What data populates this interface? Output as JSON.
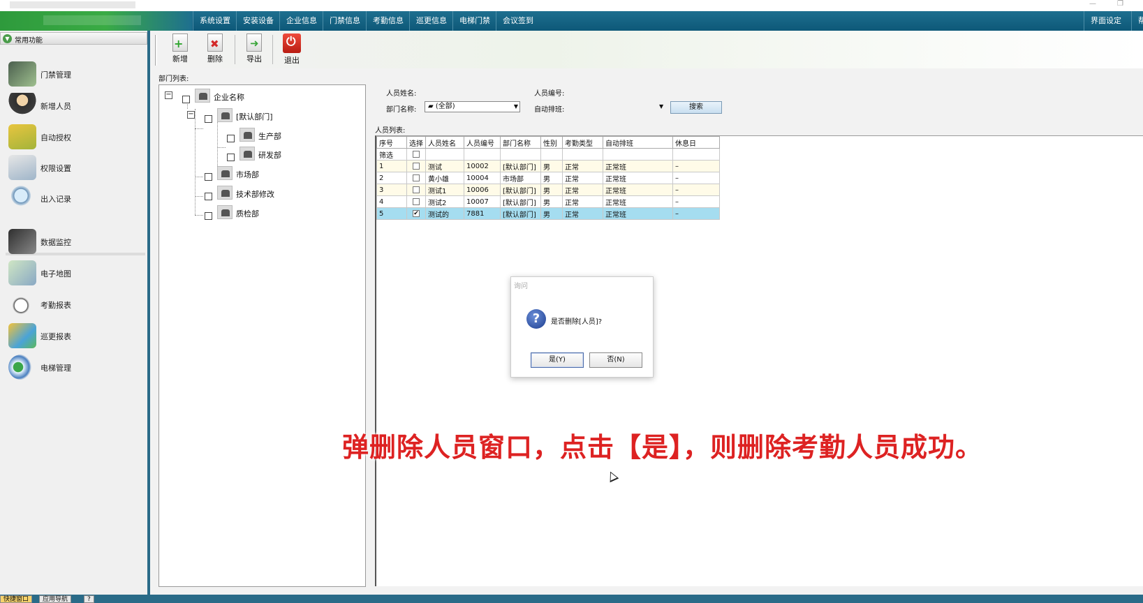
{
  "menu": {
    "items": [
      "系统设置",
      "安装设备",
      "企业信息",
      "门禁信息",
      "考勤信息",
      "巡更信息",
      "电梯门禁",
      "会议签到"
    ],
    "right_items": [
      "界面设定",
      "帮"
    ]
  },
  "sidebar": {
    "header": "常用功能",
    "items": [
      {
        "label": "门禁管理",
        "icon": "door-control-icon"
      },
      {
        "label": "新增人员",
        "icon": "person-icon"
      },
      {
        "label": "自动授权",
        "icon": "card-icon"
      },
      {
        "label": "权限设置",
        "icon": "clock-settings-icon"
      },
      {
        "label": "出入记录",
        "icon": "magnifier-icon"
      },
      {
        "label": "数据监控",
        "icon": "camera-icon"
      },
      {
        "label": "电子地图",
        "icon": "map-icon"
      },
      {
        "label": "考勤报表",
        "icon": "clock-report-icon"
      },
      {
        "label": "巡更报表",
        "icon": "patrol-report-icon"
      },
      {
        "label": "电梯管理",
        "icon": "elevator-icon"
      }
    ],
    "bottom_tabs": [
      "快捷窗口",
      "应用导航"
    ]
  },
  "toolbar": {
    "add": "新增",
    "delete": "删除",
    "export": "导出",
    "exit": "退出"
  },
  "dept": {
    "label": "部门列表:",
    "root": "企业名称",
    "default": "[默认部门]",
    "production": "生产部",
    "rnd": "研发部",
    "market": "市场部",
    "tech": "技术部修改",
    "qc": "质检部"
  },
  "filters": {
    "name_label": "人员姓名:",
    "number_label": "人员编号:",
    "dept_label": "部门名称:",
    "dept_value": "(全部)",
    "shift_label": "自动排班:",
    "search": "搜索"
  },
  "people": {
    "label": "人员列表:",
    "columns": [
      "序号",
      "选择",
      "人员姓名",
      "人员编号",
      "部门名称",
      "性别",
      "考勤类型",
      "自动排班",
      "休息日"
    ],
    "filter_row_label": "筛选",
    "rows": [
      {
        "idx": "1",
        "checked": false,
        "name": "测试",
        "no": "10002",
        "dept": "[默认部门]",
        "sex": "男",
        "type": "正常",
        "shift": "正常班",
        "rest": "–"
      },
      {
        "idx": "2",
        "checked": false,
        "name": "黄小雄",
        "no": "10004",
        "dept": "市场部",
        "sex": "男",
        "type": "正常",
        "shift": "正常班",
        "rest": "–"
      },
      {
        "idx": "3",
        "checked": false,
        "name": "测试1",
        "no": "10006",
        "dept": "[默认部门]",
        "sex": "男",
        "type": "正常",
        "shift": "正常班",
        "rest": "–"
      },
      {
        "idx": "4",
        "checked": false,
        "name": "测试2",
        "no": "10007",
        "dept": "[默认部门]",
        "sex": "男",
        "type": "正常",
        "shift": "正常班",
        "rest": "–"
      },
      {
        "idx": "5",
        "checked": true,
        "name": "测试的",
        "no": "7881",
        "dept": "[默认部门]",
        "sex": "男",
        "type": "正常",
        "shift": "正常班",
        "rest": "–"
      }
    ]
  },
  "dialog": {
    "title": "询问",
    "message": "是否删除[人员]?",
    "yes": "是(Y)",
    "no": "否(N)"
  },
  "caption": "弹删除人员窗口，点击【是】，则删除考勤人员成功。"
}
